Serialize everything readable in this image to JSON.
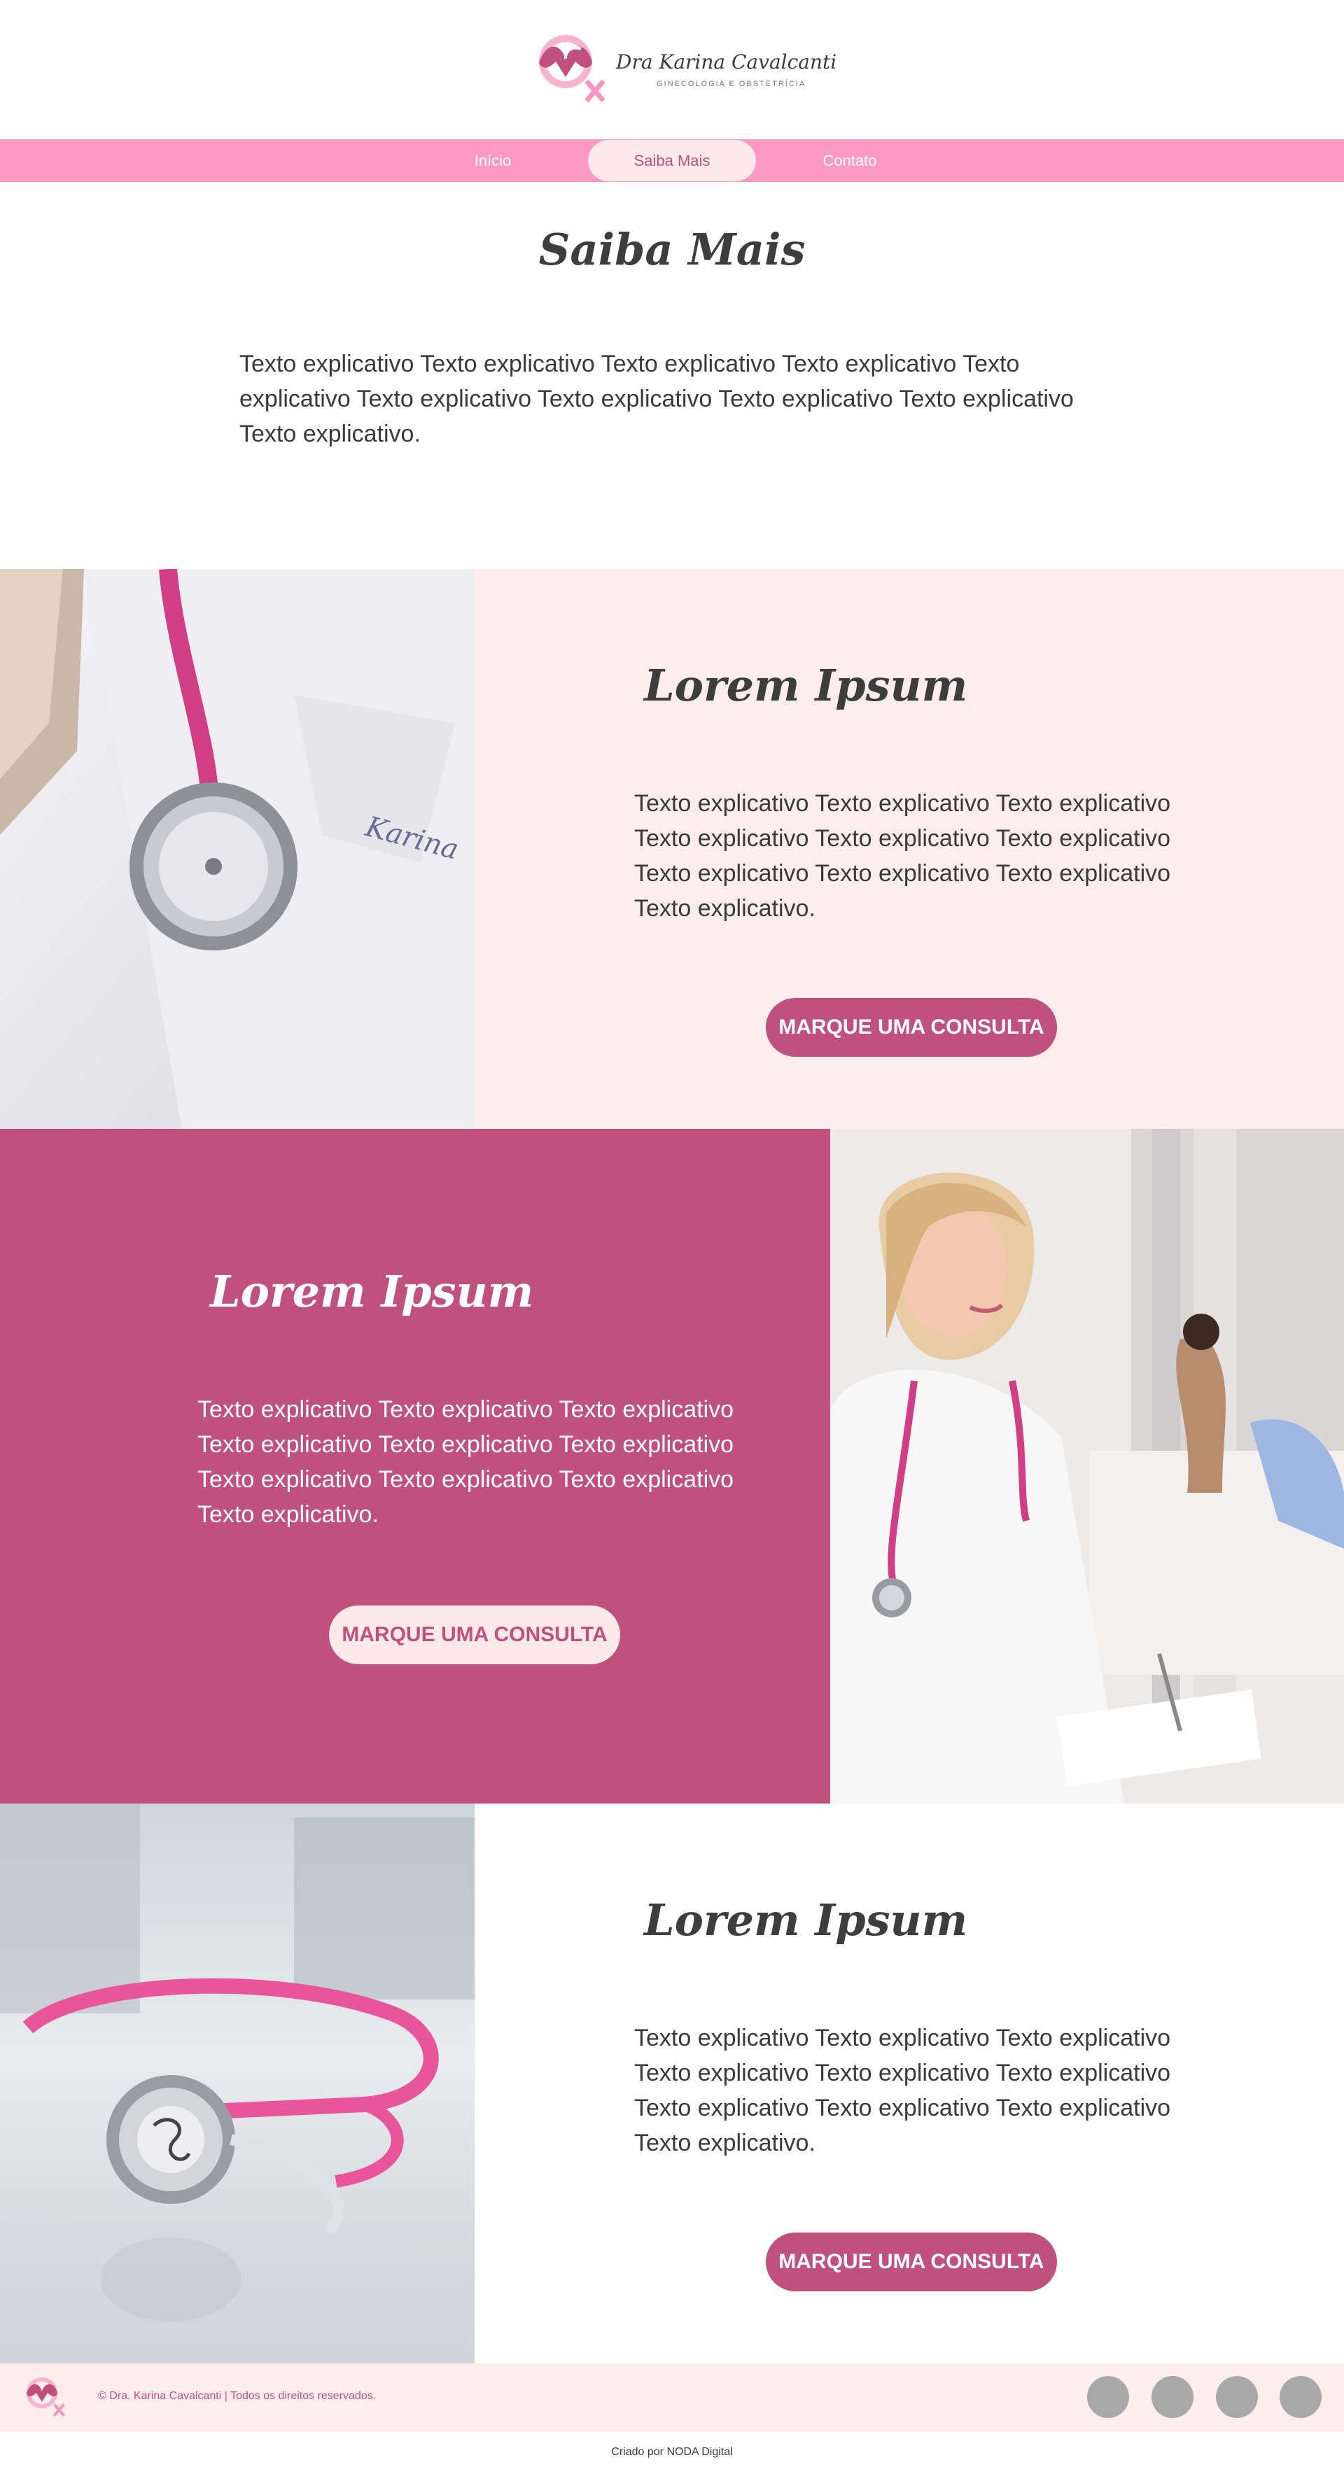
{
  "brand": {
    "name": "Dra Karina Cavalcanti",
    "subtitle": "GINECOLOGIA E OBSTETRÍCIA"
  },
  "nav": {
    "items": [
      {
        "label": "Início",
        "active": false
      },
      {
        "label": "Saiba Mais",
        "active": true
      },
      {
        "label": "Contato",
        "active": false
      }
    ]
  },
  "page": {
    "title": "Saiba Mais",
    "intro": "Texto explicativo Texto explicativo Texto explicativo Texto explicativo Texto explicativo Texto explicativo Texto explicativo Texto explicativo Texto explicativo Texto explicativo."
  },
  "sections": [
    {
      "title": "Lorem Ipsum",
      "text": "Texto explicativo Texto explicativo Texto explicativo Texto explicativo Texto explicativo Texto explicativo Texto explicativo Texto explicativo Texto explicativo Texto explicativo.",
      "cta": "MARQUE UMA CONSULTA"
    },
    {
      "title": "Lorem Ipsum",
      "text": "Texto explicativo Texto explicativo Texto explicativo Texto explicativo Texto explicativo Texto explicativo Texto explicativo Texto explicativo Texto explicativo Texto explicativo.",
      "cta": "MARQUE UMA CONSULTA"
    },
    {
      "title": "Lorem Ipsum",
      "text": "Texto explicativo Texto explicativo Texto explicativo Texto explicativo Texto explicativo Texto explicativo Texto explicativo Texto explicativo Texto explicativo Texto explicativo.",
      "cta": "MARQUE UMA CONSULTA"
    }
  ],
  "footer": {
    "copyright": "© Dra. Karina Cavalcanti | Todos os direitos reservados.",
    "credit": "Criado por NODA Digital",
    "social_count": 4
  },
  "colors": {
    "nav_pink": "#fe99c6",
    "brand_magenta": "#c0517f",
    "blush": "#fdeeed",
    "text_dark": "#3a3a3a"
  },
  "icons": [
    "logo-mark-icon",
    "social-icon"
  ]
}
